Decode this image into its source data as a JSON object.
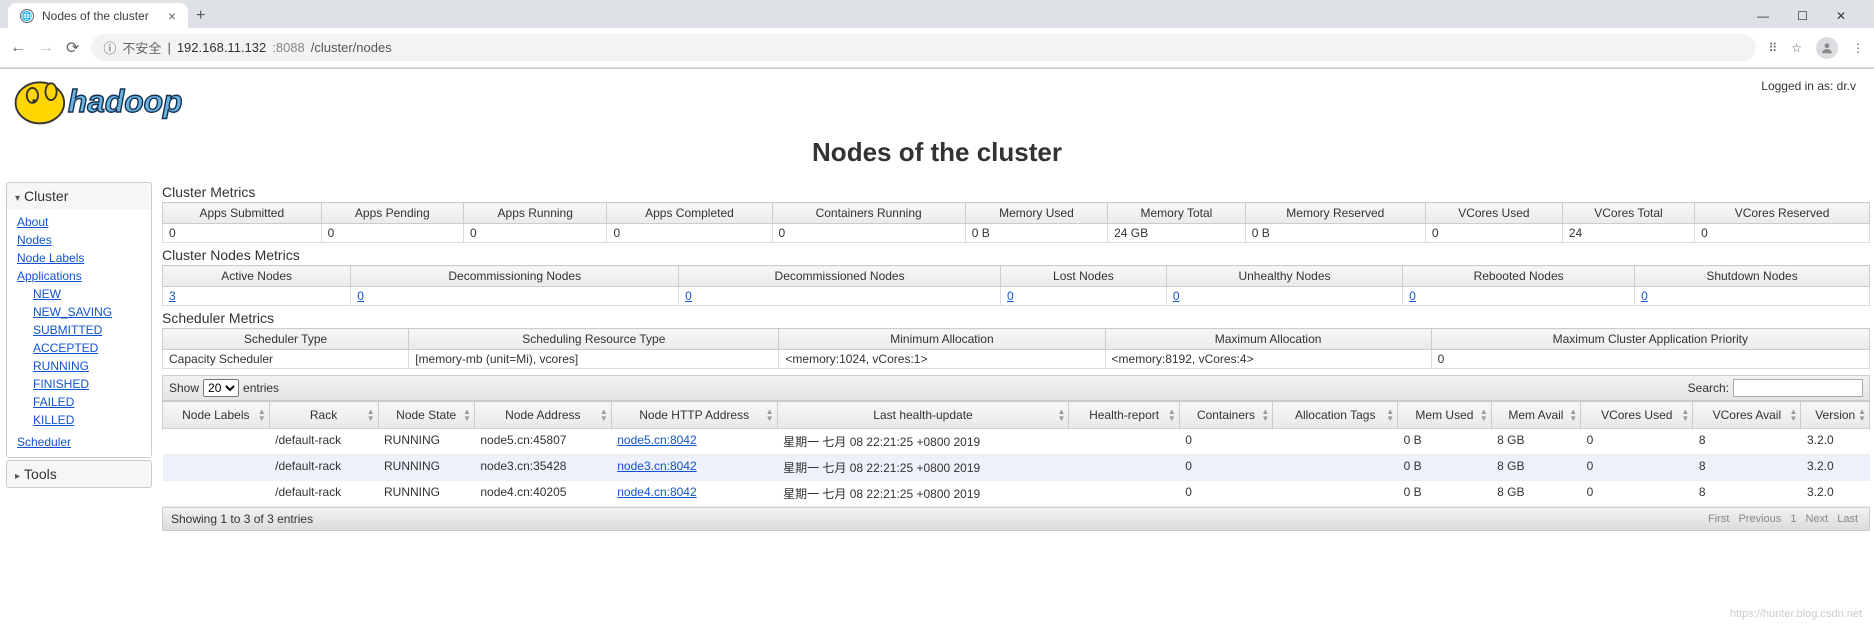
{
  "browser": {
    "tab_title": "Nodes of the cluster",
    "insecure_label": "不安全",
    "url_host": "192.168.11.132",
    "url_port": ":8088",
    "url_path": "/cluster/nodes"
  },
  "header": {
    "login_text": "Logged in as: dr.v",
    "page_title": "Nodes of the cluster"
  },
  "sidebar": {
    "cluster_label": "Cluster",
    "tools_label": "Tools",
    "links": {
      "about": "About",
      "nodes": "Nodes",
      "node_labels": "Node Labels",
      "applications": "Applications",
      "new": "NEW",
      "new_saving": "NEW_SAVING",
      "submitted": "SUBMITTED",
      "accepted": "ACCEPTED",
      "running": "RUNNING",
      "finished": "FINISHED",
      "failed": "FAILED",
      "killed": "KILLED",
      "scheduler": "Scheduler"
    }
  },
  "cluster_metrics": {
    "title": "Cluster Metrics",
    "headers": [
      "Apps Submitted",
      "Apps Pending",
      "Apps Running",
      "Apps Completed",
      "Containers Running",
      "Memory Used",
      "Memory Total",
      "Memory Reserved",
      "VCores Used",
      "VCores Total",
      "VCores Reserved"
    ],
    "values": [
      "0",
      "0",
      "0",
      "0",
      "0",
      "0 B",
      "24 GB",
      "0 B",
      "0",
      "24",
      "0"
    ]
  },
  "cluster_nodes_metrics": {
    "title": "Cluster Nodes Metrics",
    "headers": [
      "Active Nodes",
      "Decommissioning Nodes",
      "Decommissioned Nodes",
      "Lost Nodes",
      "Unhealthy Nodes",
      "Rebooted Nodes",
      "Shutdown Nodes"
    ],
    "values": [
      "3",
      "0",
      "0",
      "0",
      "0",
      "0",
      "0"
    ]
  },
  "scheduler_metrics": {
    "title": "Scheduler Metrics",
    "headers": [
      "Scheduler Type",
      "Scheduling Resource Type",
      "Minimum Allocation",
      "Maximum Allocation",
      "Maximum Cluster Application Priority"
    ],
    "values": [
      "Capacity Scheduler",
      "[memory-mb (unit=Mi), vcores]",
      "<memory:1024, vCores:1>",
      "<memory:8192, vCores:4>",
      "0"
    ]
  },
  "datatable": {
    "show_label_pre": "Show",
    "show_label_post": "entries",
    "show_value": "20",
    "search_label": "Search:",
    "columns": [
      "Node Labels",
      "Rack",
      "Node State",
      "Node Address",
      "Node HTTP Address",
      "Last health-update",
      "Health-report",
      "Containers",
      "Allocation Tags",
      "Mem Used",
      "Mem Avail",
      "VCores Used",
      "VCores Avail",
      "Version"
    ],
    "rows": [
      {
        "labels": "",
        "rack": "/default-rack",
        "state": "RUNNING",
        "addr": "node5.cn:45807",
        "http": "node5.cn:8042",
        "last": "星期一 七月 08 22:21:25 +0800 2019",
        "report": "",
        "containers": "0",
        "alloc": "",
        "memused": "0 B",
        "memavail": "8 GB",
        "vcused": "0",
        "vcavail": "8",
        "ver": "3.2.0"
      },
      {
        "labels": "",
        "rack": "/default-rack",
        "state": "RUNNING",
        "addr": "node3.cn:35428",
        "http": "node3.cn:8042",
        "last": "星期一 七月 08 22:21:25 +0800 2019",
        "report": "",
        "containers": "0",
        "alloc": "",
        "memused": "0 B",
        "memavail": "8 GB",
        "vcused": "0",
        "vcavail": "8",
        "ver": "3.2.0"
      },
      {
        "labels": "",
        "rack": "/default-rack",
        "state": "RUNNING",
        "addr": "node4.cn:40205",
        "http": "node4.cn:8042",
        "last": "星期一 七月 08 22:21:25 +0800 2019",
        "report": "",
        "containers": "0",
        "alloc": "",
        "memused": "0 B",
        "memavail": "8 GB",
        "vcused": "0",
        "vcavail": "8",
        "ver": "3.2.0"
      }
    ],
    "footer_info": "Showing 1 to 3 of 3 entries",
    "pager": {
      "first": "First",
      "prev": "Previous",
      "page": "1",
      "next": "Next",
      "last": "Last"
    }
  },
  "watermark": "https://hunter.blog.csdn.net"
}
